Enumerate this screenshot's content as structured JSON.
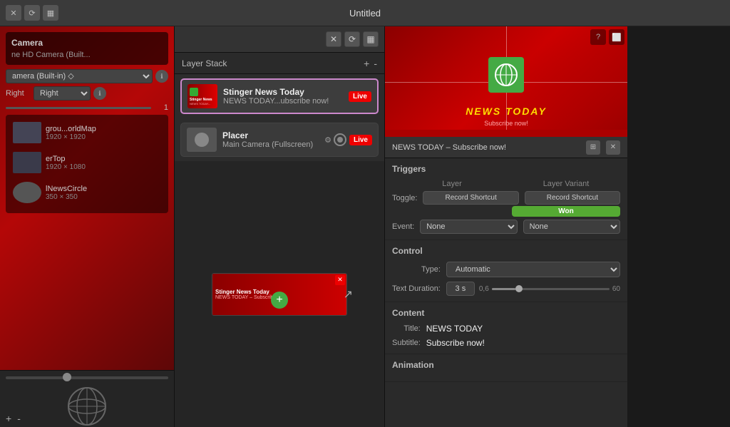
{
  "window": {
    "title": "Untitled",
    "close_btn": "✕",
    "restore_btn": "⧉",
    "film_btn": "⬛"
  },
  "left_panel": {
    "camera_title": "Camera",
    "camera_subtitle": "ne HD Camera (Built...",
    "camera_select_label": "amera (Built-in) ◇",
    "direction_label": "Right",
    "slider_value": "1",
    "layers": [
      {
        "name": "grou...orldMap",
        "size": "1920 × 1920"
      },
      {
        "name": "erTop",
        "size": "1920 × 1080"
      },
      {
        "name": "lNewsCircle",
        "size": "350 × 350"
      }
    ],
    "add_btn": "+",
    "remove_btn": "-"
  },
  "middle_panel": {
    "layer_stack_title": "Layer Stack",
    "add_btn": "+",
    "remove_btn": "-",
    "layers": [
      {
        "name": "Stinger News Today",
        "subtitle": "NEWS TODAY...ubscribe now!",
        "type": "stinger",
        "live": true,
        "active": true
      },
      {
        "name": "Placer",
        "subtitle": "Main Camera (Fullscreen)",
        "type": "placer",
        "live": true,
        "active": false
      }
    ],
    "mini_preview_label": "Stinger News Today",
    "mini_preview_sub": "NEWS TODAY – Subscribe now",
    "add_circle": "+"
  },
  "right_panel": {
    "preview_news_title": "NEWS TODAY",
    "preview_subtitle": "Subscribe now!",
    "info_bar_title": "NEWS TODAY – Subscribe now!",
    "triggers_section": "Triggers",
    "triggers_col_layer": "Layer",
    "triggers_col_variant": "Layer Variant",
    "toggle_label": "Toggle:",
    "event_label": "Event:",
    "toggle_layer_btn": "Record Shortcut",
    "toggle_variant_btn": "Record Shortcut",
    "event_layer_value": "None",
    "event_variant_value": "None",
    "won_label": "Won",
    "control_section": "Control",
    "type_label": "Type:",
    "type_value": "Automatic",
    "duration_label": "Text Duration:",
    "duration_value": "3 s",
    "range_min": "0,6",
    "range_max": "60",
    "content_section": "Content",
    "title_label": "Title:",
    "title_value": "NEWS TODAY",
    "subtitle_label": "Subtitle:",
    "subtitle_value": "Subscribe now!",
    "animation_section": "Animation"
  }
}
